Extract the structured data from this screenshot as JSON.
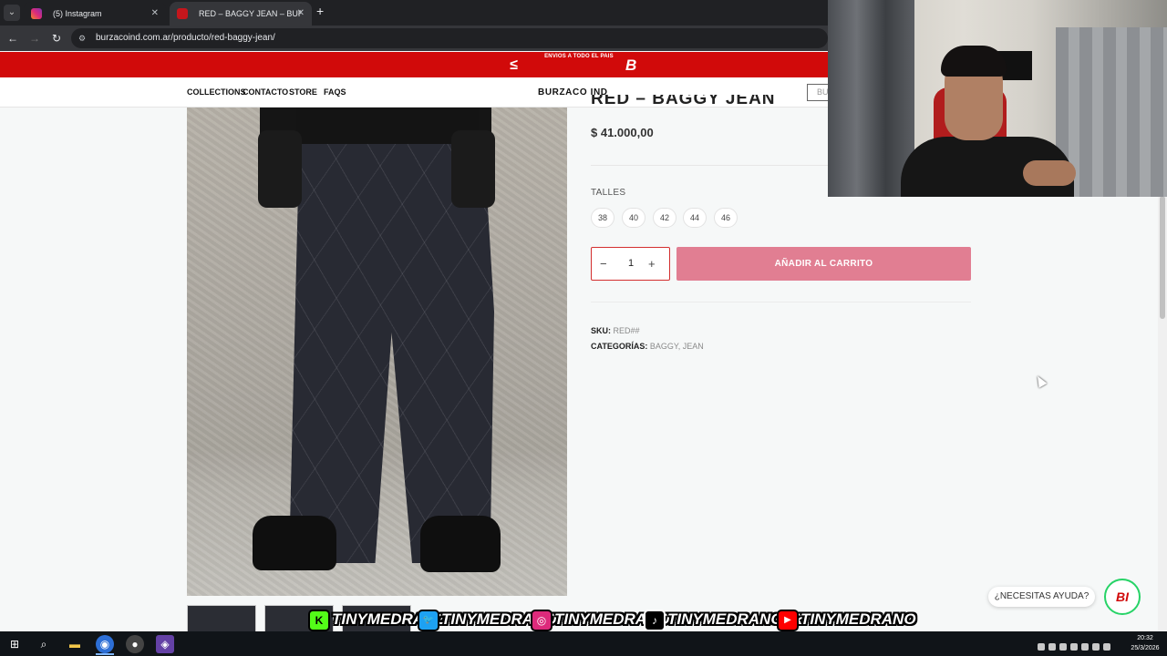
{
  "browser": {
    "tabs": [
      {
        "title": "(5) Instagram",
        "active": false
      },
      {
        "title": "RED – BAGGY JEAN – BURZACO",
        "active": true
      }
    ],
    "new_tab": "+",
    "close": "✕",
    "url": "burzacoind.com.ar/producto/red-baggy-jean/"
  },
  "promo": {
    "text": "ENVIOS A TODO EL PAIS",
    "logo_left": "≤",
    "logo_right": "B"
  },
  "nav": {
    "items": [
      "COLLECTIONS",
      "CONTACTO",
      "STORE",
      "FAQS"
    ],
    "brand": "BURZACO IND",
    "search_placeholder": "BUSCAR"
  },
  "product": {
    "title": "RED – BAGGY JEAN",
    "price": "$ 41.000,00",
    "sizes_label": "TALLES",
    "sizes": [
      "38",
      "40",
      "42",
      "44",
      "46"
    ],
    "quantity": "1",
    "minus": "−",
    "plus": "+",
    "add_to_cart": "AÑADIR AL CARRITO",
    "sku_label": "SKU:",
    "sku": "RED##",
    "categories_label": "CATEGORÍAS:",
    "categories": [
      "BAGGY",
      "JEAN"
    ]
  },
  "help": {
    "label": "¿NECESITAS AYUDA?",
    "logo": "BI"
  },
  "socials": [
    {
      "icon": "kick-icon",
      "glyph": "K",
      "color": "#53fc18",
      "handle": "TINYMEDRANO"
    },
    {
      "icon": "twitter-icon",
      "glyph": "🐦",
      "color": "#1da1f2",
      "handle": "TINYMEDRANO"
    },
    {
      "icon": "instagram-icon",
      "glyph": "◎",
      "color": "#dd2a7b",
      "handle": "TINYMEDRANO"
    },
    {
      "icon": "tiktok-icon",
      "glyph": "♪",
      "color": "#000000",
      "handle": "TINYMEDRANOJR"
    },
    {
      "icon": "youtube-icon",
      "glyph": "▶",
      "color": "#ff0000",
      "handle": "TINYMEDRANO"
    }
  ],
  "taskbar": {
    "time": "20:32",
    "date": "25/3/2026"
  },
  "colors": {
    "brand_red": "#d10a0a",
    "cart_pink": "#e17e92",
    "whatsapp_green": "#27d367"
  }
}
